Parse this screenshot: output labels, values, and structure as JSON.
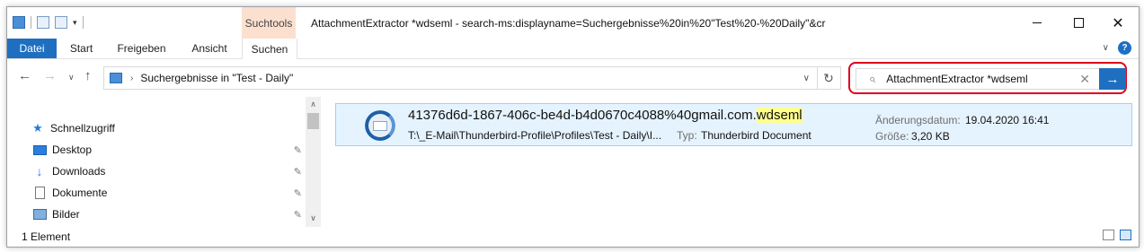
{
  "window": {
    "title": "AttachmentExtractor *wdseml - search-ms:displayname=Suchergebnisse%20in%20\"Test%20-%20Daily\"&cr",
    "contextual_tab": "Suchtools",
    "controls": {
      "minimize": "─",
      "maximize": "☐",
      "close": "✕"
    }
  },
  "ribbon": {
    "tabs": [
      {
        "label": "Datei"
      },
      {
        "label": "Start"
      },
      {
        "label": "Freigeben"
      },
      {
        "label": "Ansicht"
      },
      {
        "label": "Suchen"
      }
    ],
    "expand_glyph": "∨",
    "help_glyph": "?"
  },
  "nav": {
    "back_glyph": "←",
    "forward_glyph": "→",
    "recent_glyph": "∨",
    "up_glyph": "↑",
    "address_chevron": "›",
    "breadcrumb": "Suchergebnisse in \"Test - Daily\"",
    "address_dropdown_glyph": "∨",
    "refresh_glyph": "↻"
  },
  "search": {
    "value": "AttachmentExtractor *wdseml",
    "search_glyph": "⌕",
    "clear_glyph": "✕",
    "go_glyph": "→"
  },
  "sidebar": {
    "items": [
      {
        "label": "Schnellzugriff",
        "icon": "star-icon"
      },
      {
        "label": "Desktop",
        "icon": "desktop-icon",
        "pinned": true
      },
      {
        "label": "Downloads",
        "icon": "download-icon",
        "pinned": true
      },
      {
        "label": "Dokumente",
        "icon": "documents-icon",
        "pinned": true
      },
      {
        "label": "Bilder",
        "icon": "pictures-icon",
        "pinned": true
      }
    ],
    "pin_glyph": "📌",
    "scroll_up_glyph": "∧",
    "scroll_down_glyph": "∨"
  },
  "results": [
    {
      "name_prefix": "41376d6d-1867-406c-be4d-b4d0670c4088%40gmail.com.",
      "name_highlight": "wdseml",
      "path": "T:\\_E-Mail\\Thunderbird-Profile\\Profiles\\Test - Daily\\I...",
      "type_label": "Typ:",
      "type_value": "Thunderbird Document",
      "date_label": "Änderungsdatum:",
      "date_value": "19.04.2020 16:41",
      "size_label": "Größe:",
      "size_value": "3,20 KB",
      "icon": "thunderbird-icon"
    }
  ],
  "status": {
    "item_count": "1 Element"
  },
  "colors": {
    "accent": "#1e6fc0",
    "contextual_tab": "#fbe0cf",
    "selection_bg": "#e5f3ff",
    "search_outline": "#e0001b",
    "highlight": "#ffff8c"
  }
}
